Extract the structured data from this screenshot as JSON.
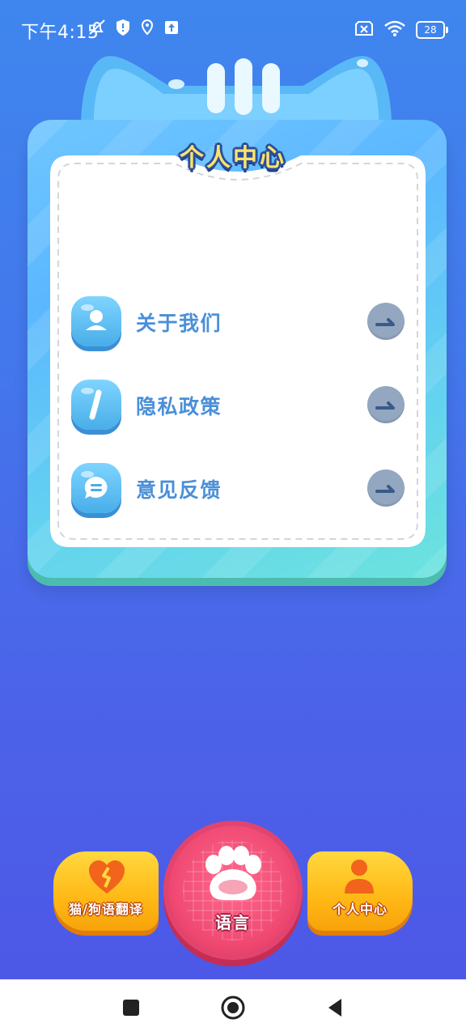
{
  "status_bar": {
    "time": "下午4:15",
    "battery": "28",
    "icons": [
      "mute-bell-icon",
      "shield-icon",
      "location-icon",
      "upload-icon",
      "sim-off-icon",
      "wifi-icon",
      "battery-icon"
    ]
  },
  "card": {
    "title": "个人中心",
    "items": [
      {
        "label": "关于我们",
        "icon": "person-icon",
        "arrow": "arrow-right-icon"
      },
      {
        "label": "隐私政策",
        "icon": "info-icon",
        "arrow": "arrow-right-icon"
      },
      {
        "label": "意见反馈",
        "icon": "chat-icon",
        "arrow": "arrow-right-icon"
      }
    ]
  },
  "bottom_nav": {
    "left_label": "猫/狗语翻译",
    "center_label": "语言",
    "right_label": "个人中心",
    "left_icon": "heart-icon",
    "center_icon": "paw-icon",
    "right_icon": "person-icon"
  },
  "system_nav": {
    "buttons": [
      "recent-apps-icon",
      "home-icon",
      "back-icon"
    ]
  },
  "colors": {
    "background_top": "#3f86ee",
    "background_bottom": "#4d56e6",
    "card_blue": "#5cb7ff",
    "accent_yellow": "#ffb815",
    "center_pink": "#f04a73",
    "label_blue": "#4a8fd8"
  }
}
